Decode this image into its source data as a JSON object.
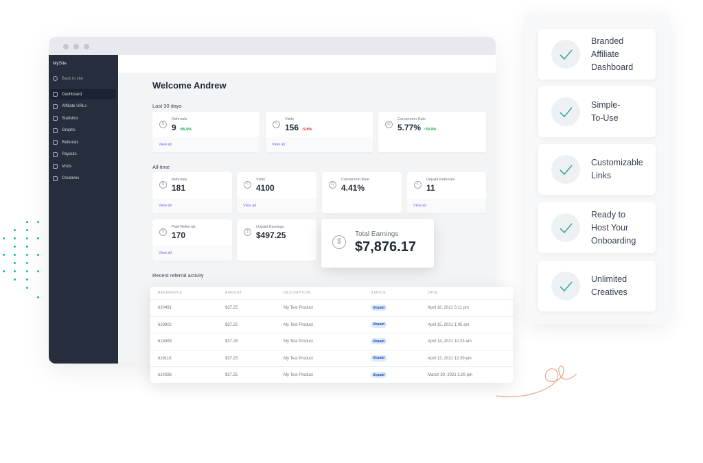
{
  "sidebar": {
    "site": "MySite",
    "back": "Back to site",
    "items": [
      {
        "label": "Dashboard",
        "icon": "home-icon"
      },
      {
        "label": "Affiliate URLs",
        "icon": "link-icon"
      },
      {
        "label": "Statistics",
        "icon": "pie-chart-icon"
      },
      {
        "label": "Graphs",
        "icon": "bar-chart-icon"
      },
      {
        "label": "Referrals",
        "icon": "credit-card-icon"
      },
      {
        "label": "Payouts",
        "icon": "cash-icon"
      },
      {
        "label": "Visits",
        "icon": "cursor-click-icon"
      },
      {
        "label": "Creatives",
        "icon": "image-icon"
      }
    ]
  },
  "welcome": "Welcome Andrew",
  "last30": {
    "title": "Last 30 days",
    "cards": [
      {
        "label": "Referrals",
        "value": "9",
        "change": "55.6%",
        "dir": "up",
        "link": "View all"
      },
      {
        "label": "Visits",
        "value": "156",
        "change": "9.8%",
        "dir": "down",
        "link": "View all"
      },
      {
        "label": "Conversion Rate",
        "value": "5.77%",
        "change": "59.9%",
        "dir": "up"
      }
    ]
  },
  "alltime": {
    "title": "All-time",
    "cards": [
      {
        "label": "Referrals",
        "value": "181",
        "link": "View all"
      },
      {
        "label": "Visits",
        "value": "4100",
        "link": "View all"
      },
      {
        "label": "Conversion Rate",
        "value": "4.41%"
      },
      {
        "label": "Unpaid Referrals",
        "value": "11",
        "link": "View all"
      },
      {
        "label": "Paid Referrals",
        "value": "170",
        "link": "View all"
      },
      {
        "label": "Unpaid Earnings",
        "value": "$497.25"
      }
    ]
  },
  "total": {
    "label": "Total Earnings",
    "value": "$7,876.17"
  },
  "recent": {
    "title": "Recent referral activity",
    "headers": [
      "REFERENCE",
      "AMOUNT",
      "DESCRIPTION",
      "STATUS",
      "DATE"
    ],
    "rows": [
      [
        "620491",
        "$37.25",
        "My Test Product",
        "Unpaid",
        "April 16, 2021 5:11 pm"
      ],
      [
        "619802",
        "$37.25",
        "My Test Product",
        "Unpaid",
        "April 15, 2021 1:05 am"
      ],
      [
        "619499",
        "$37.25",
        "My Test Product",
        "Unpaid",
        "April 14, 2021 10:23 am"
      ],
      [
        "619116",
        "$37.25",
        "My Test Product",
        "Unpaid",
        "April 13, 2021 12:39 pm"
      ],
      [
        "614286",
        "$37.25",
        "My Test Product",
        "Unpaid",
        "March 30, 2021 5:29 pm"
      ]
    ]
  },
  "features": [
    "Branded\nAffiliate\nDashboard",
    "Simple-\nTo-Use",
    "Customizable\nLinks",
    "Ready to\nHost Your\nOnboarding",
    "Unlimited\nCreatives"
  ],
  "colors": {
    "sidebar": "#262e3e",
    "accent": "#6366f1",
    "teal": "#14b8a6",
    "up": "#16a34a",
    "down": "#dc2626"
  }
}
